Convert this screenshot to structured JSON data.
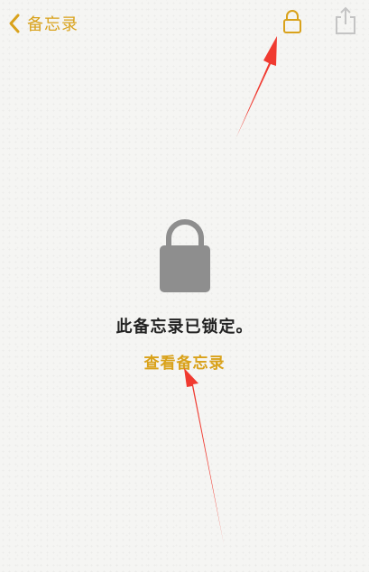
{
  "theme": {
    "accent": "#d9a21b",
    "lock_gray": "#8e8e8e",
    "share_gray": "#c4c4c4",
    "annotation": "#f03a30"
  },
  "nav": {
    "back_label": "备忘录",
    "back_icon": "chevron-left-icon",
    "lock_icon": "lock-icon",
    "share_icon": "share-icon"
  },
  "content": {
    "lock_icon": "lock-icon",
    "message": "此备忘录已锁定。",
    "view_link": "查看备忘录"
  },
  "annotations": {
    "arrow_icon": "arrow-icon"
  }
}
